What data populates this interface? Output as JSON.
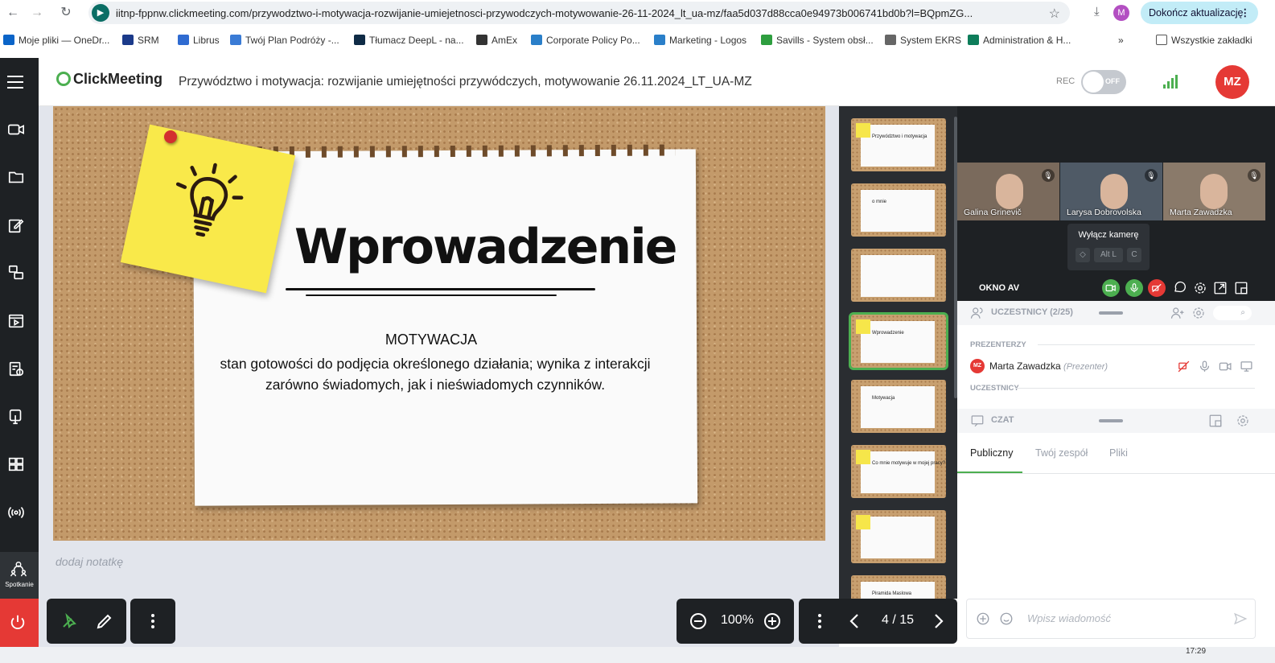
{
  "browser": {
    "url": "iitnp-fppnw.clickmeeting.com/przywodztwo-i-motywacja-rozwijanie-umiejetnosci-przywodczych-motywowanie-26-11-2024_lt_ua-mz/faa5d037d88cca0e94973b006741bd0b?l=BQpmZG...",
    "profile_initial": "M",
    "update_button": "Dokończ aktualizację",
    "bookmarks": [
      {
        "label": "Moje pliki — OneDr...",
        "color": "#0a64c8"
      },
      {
        "label": "SRM",
        "color": "#1b3a8a"
      },
      {
        "label": "Librus",
        "color": "#2f6bd1"
      },
      {
        "label": "Twój Plan Podróży -...",
        "color": "#3a7bd5"
      },
      {
        "label": "Tłumacz DeepL - na...",
        "color": "#0f2b46"
      },
      {
        "label": "AmEx",
        "color": "#333333"
      },
      {
        "label": "Corporate Policy Po...",
        "color": "#2a7fc9"
      },
      {
        "label": "Marketing - Logos",
        "color": "#2a7fc9"
      },
      {
        "label": "Savills - System obsł...",
        "color": "#2e9e3f"
      },
      {
        "label": "System EKRS",
        "color": "#666666"
      },
      {
        "label": "Administration & H...",
        "color": "#0d7d5a"
      }
    ],
    "all_bookmarks": "Wszystkie zakładki"
  },
  "header": {
    "logo": "ClickMeeting",
    "meeting_title": "Przywództwo i motywacja: rozwijanie umiejętności przywódczych, motywowanie 26.11.2024_LT_UA-MZ",
    "rec_label": "REC",
    "rec_state": "OFF",
    "user_initials": "MZ"
  },
  "sidebar": {
    "meeting_label": "Spotkanie"
  },
  "slide": {
    "title": "Wprowadzenie",
    "heading": "MOTYWACJA",
    "text": "stan gotowości do podjęcia określonego działania; wynika z interakcji zarówno świadomych, jak i nieświadomych czynników."
  },
  "notes": {
    "placeholder": "dodaj notatkę"
  },
  "thumbnails": [
    {
      "label": "Przywództwo i motywacja",
      "active": false
    },
    {
      "label": "o mnie",
      "active": false
    },
    {
      "label": "",
      "active": false
    },
    {
      "label": "Wprowadzenie",
      "active": true
    },
    {
      "label": "Motywacja",
      "active": false
    },
    {
      "label": "Co mnie motywuje w mojej pracy?",
      "active": false
    },
    {
      "label": "",
      "active": false
    },
    {
      "label": "Piramida Maslowa",
      "active": false
    }
  ],
  "toolbar": {
    "zoom": "100%",
    "page": "4 / 15"
  },
  "video": {
    "tiles": [
      {
        "name": "Galina Grinevič"
      },
      {
        "name": "Larysa Dobrovolska"
      },
      {
        "name": "Marta Zawadzka"
      }
    ],
    "tooltip_title": "Wyłącz kamerę",
    "tooltip_keys": [
      "◇",
      "Alt L",
      "C"
    ],
    "av_label": "OKNO AV"
  },
  "participants": {
    "title": "UCZESTNICY (2/25)",
    "presenters_label": "PREZENTERZY",
    "presenter_initials": "MZ",
    "presenter_name": "Marta Zawadzka",
    "presenter_role": "(Prezenter)",
    "attendees_label": "UCZESTNICY"
  },
  "chat": {
    "title": "CZAT",
    "tabs": [
      "Publiczny",
      "Twój zespół",
      "Pliki"
    ],
    "placeholder": "Wpisz wiadomość"
  },
  "taskbar": {
    "clock": "17:29"
  },
  "colors": {
    "accent": "#4caf50",
    "brand_red": "#e53935",
    "dark_ui": "#1e2124"
  }
}
